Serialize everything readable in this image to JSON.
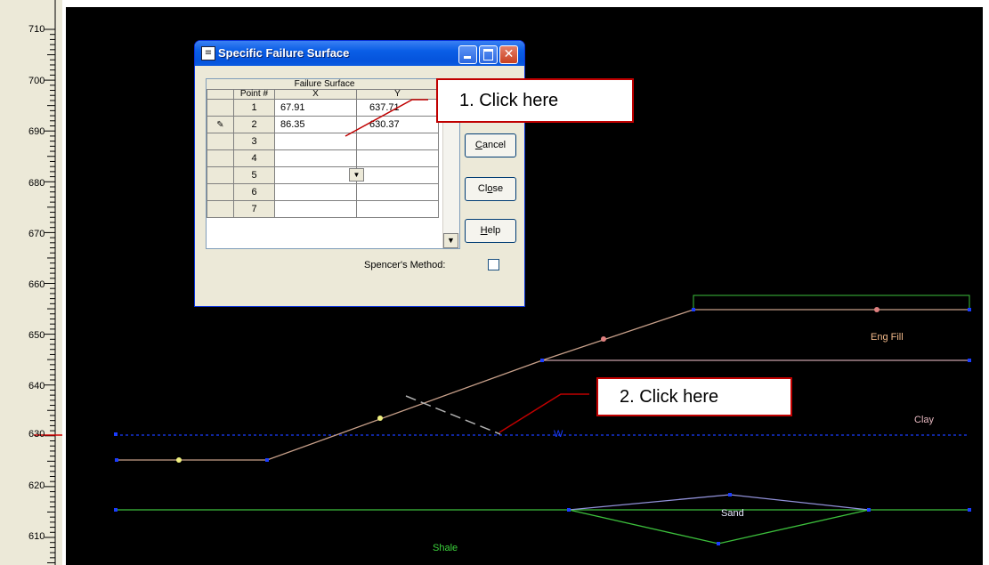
{
  "ruler": {
    "labels": [
      "710",
      "700",
      "690",
      "680",
      "670",
      "660",
      "650",
      "640",
      "630",
      "620",
      "610"
    ]
  },
  "dialog": {
    "title": "Specific Failure Surface",
    "grid_title": "Failure Surface",
    "columns": [
      "Point #",
      "X",
      "Y"
    ],
    "rows": [
      {
        "num": "1",
        "x": "67.91",
        "y": "637.71",
        "editing": false
      },
      {
        "num": "2",
        "x": "86.35",
        "y": "630.37",
        "editing": true
      },
      {
        "num": "3",
        "x": "",
        "y": "",
        "editing": false
      },
      {
        "num": "4",
        "x": "",
        "y": "",
        "editing": false
      },
      {
        "num": "5",
        "x": "",
        "y": "",
        "editing": false
      },
      {
        "num": "6",
        "x": "",
        "y": "",
        "editing": false
      },
      {
        "num": "7",
        "x": "",
        "y": "",
        "editing": false
      }
    ],
    "buttons": {
      "cancel": "Cancel",
      "close": "Close",
      "help": "Help"
    },
    "spencer_label": "Spencer's Method:",
    "spencer_checked": false
  },
  "callouts": {
    "one": "1.    Click here",
    "two": "2.    Click here"
  },
  "materials": {
    "eng_fill": "Eng Fill",
    "clay": "Clay",
    "sand": "Sand",
    "shale": "Shale",
    "water_marker": "W"
  },
  "colors": {
    "canvas": "#000000",
    "callout_border": "#c00000",
    "surface_line": "#c8a08a",
    "ground_green": "#3cbf3c",
    "water_blue": "#1a3cff"
  }
}
